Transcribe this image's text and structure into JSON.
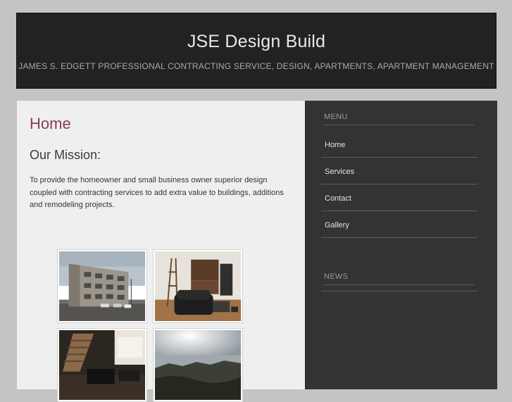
{
  "site": {
    "title": "JSE Design Build",
    "tagline": "JAMES S. EDGETT PROFESSIONAL CONTRACTING SERVICE, DESIGN, APARTMENTS, APARTMENT MANAGEMENT"
  },
  "main": {
    "page_title": "Home",
    "mission_heading": "Our Mission:",
    "mission_text": "To provide the homeowner and small business owner superior design coupled with contracting services to add extra value to buildings, additions and remodeling projects."
  },
  "sidebar": {
    "menu_title": "MENU",
    "menu_items": [
      {
        "label": "Home"
      },
      {
        "label": "Services"
      },
      {
        "label": "Contact"
      },
      {
        "label": "Gallery"
      }
    ],
    "news_title": "NEWS"
  },
  "colors": {
    "background": "#c4c4c4",
    "header_bg": "#222222",
    "content_bg": "#efefef",
    "sidebar_bg": "#333333",
    "accent": "#8e3a59"
  }
}
